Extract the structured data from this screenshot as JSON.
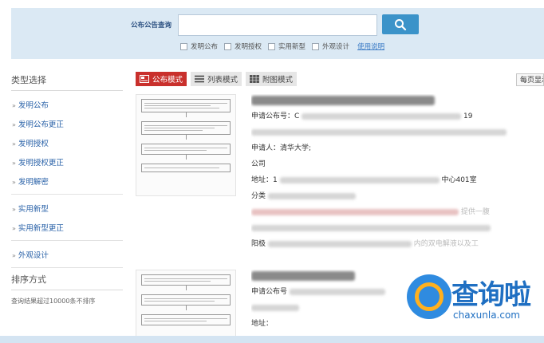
{
  "search": {
    "label": "公布公告查询",
    "input_value": "",
    "button_icon": "search-icon",
    "options": [
      "发明公布",
      "发明授权",
      "实用新型",
      "外观设计"
    ],
    "help_link": "使用说明"
  },
  "sidebar": {
    "category_title": "类型选择",
    "group1": [
      "发明公布",
      "发明公布更正",
      "发明授权",
      "发明授权更正",
      "发明解密"
    ],
    "group2": [
      "实用新型",
      "实用新型更正"
    ],
    "group3": [
      "外观设计"
    ],
    "sort_title": "排序方式",
    "sort_note": "查询结果超过10000条不排序"
  },
  "toolbar": {
    "tabs": [
      {
        "label": "公布模式",
        "icon": "publish-icon"
      },
      {
        "label": "列表模式",
        "icon": "list-icon"
      },
      {
        "label": "附图模式",
        "icon": "grid-icon"
      }
    ],
    "per_page_label": "每页显示"
  },
  "results": [
    {
      "app_no_label": "申请公布号：C",
      "app_date_tail": "19",
      "applicant": "申请人：清华大学;",
      "company": "公司",
      "address_label": "地址：1",
      "address_tail": "中心401室",
      "class_label": "分类",
      "abstract_tail": "提供一腹",
      "line_tail": "阳极",
      "extra_tail": "内的双电解液以及工"
    },
    {
      "app_no_label": "申请公布号",
      "address_label": "地址："
    }
  ],
  "watermark": {
    "brand": "查询啦",
    "domain": "chaxunla.com"
  },
  "colors": {
    "header_bg": "#dbe9f4",
    "search_button": "#3b93c9",
    "active_tab": "#c9302c",
    "link": "#2a62a8"
  }
}
